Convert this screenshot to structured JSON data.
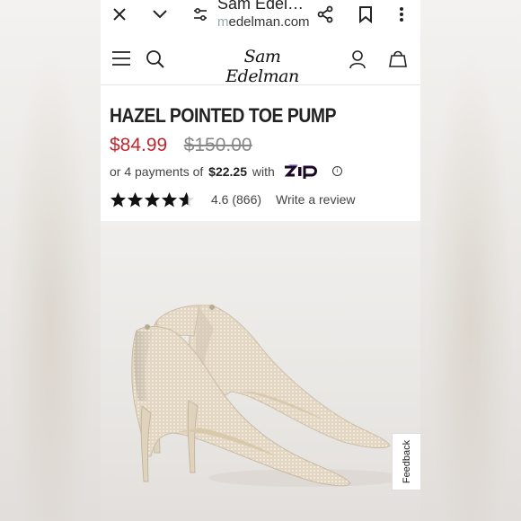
{
  "browser": {
    "tab_title": "Sam Edel…",
    "url_prefix": "m",
    "url": "edelman.com"
  },
  "site": {
    "logo_text": "Sam Edelman"
  },
  "product": {
    "title": "HAZEL POINTED TOE PUMP",
    "sale_price": "$84.99",
    "original_price": "$150.00",
    "installment_prefix": "or 4 payments of",
    "installment_amount": "$22.25",
    "installment_with": "with",
    "installment_provider": "Zip",
    "rating_value": 4.6,
    "rating_text": "4.6 (866)",
    "write_review": "Write a review"
  },
  "feedback": {
    "label": "Feedback"
  },
  "colors": {
    "sale_price": "#c0282d",
    "text": "#222222",
    "zip_accent": "#aa8fff"
  },
  "icons": [
    "close-icon",
    "chevron-down-icon",
    "tune-icon",
    "share-icon",
    "bookmark-icon",
    "more-vert-icon",
    "menu-icon",
    "search-icon",
    "account-icon",
    "bag-icon",
    "info-icon",
    "star-icon"
  ]
}
